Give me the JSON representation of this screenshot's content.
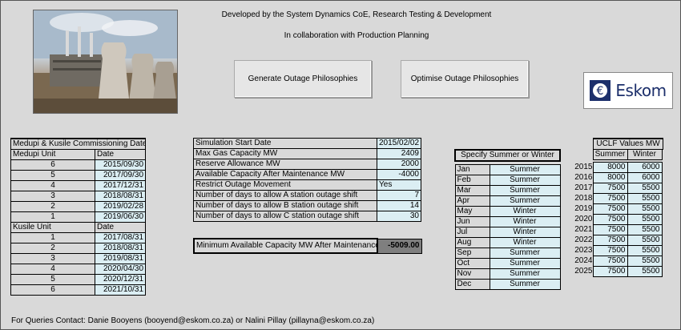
{
  "header": {
    "line1": "Developed by the System Dynamics CoE, Research Testing & Development",
    "line2": "In collaboration with Production Planning"
  },
  "buttons": {
    "generate": "Generate Outage Philosophies",
    "optimise": "Optimise Outage Philosophies"
  },
  "logo": {
    "text": "Eskom",
    "icon": "eskom-logo-icon"
  },
  "commissioning": {
    "title": "Medupi & Kusile Commissioning Dates",
    "medupi_header": [
      "Medupi Unit",
      "Date"
    ],
    "medupi": [
      {
        "unit": "6",
        "date": "2015/09/30"
      },
      {
        "unit": "5",
        "date": "2017/09/30"
      },
      {
        "unit": "4",
        "date": "2017/12/31"
      },
      {
        "unit": "3",
        "date": "2018/08/31"
      },
      {
        "unit": "2",
        "date": "2019/02/28"
      },
      {
        "unit": "1",
        "date": "2019/06/30"
      }
    ],
    "kusile_header": [
      "Kusile Unit",
      "Date"
    ],
    "kusile": [
      {
        "unit": "1",
        "date": "2017/08/31"
      },
      {
        "unit": "2",
        "date": "2018/08/31"
      },
      {
        "unit": "3",
        "date": "2019/08/31"
      },
      {
        "unit": "4",
        "date": "2020/04/30"
      },
      {
        "unit": "5",
        "date": "2020/12/31"
      },
      {
        "unit": "6",
        "date": "2021/10/31"
      }
    ]
  },
  "simulation": {
    "rows": [
      {
        "label": "Simulation Start Date",
        "value": "2015/02/02"
      },
      {
        "label": "Max Gas Capacity MW",
        "value": "2409"
      },
      {
        "label": "Reserve Allowance MW",
        "value": "2000"
      },
      {
        "label": "Available Capacity After Maintenance MW",
        "value": "-4000"
      },
      {
        "label": "Restrict Outage Movement",
        "value": "Yes"
      },
      {
        "label": "Number of days to allow A station outage shift",
        "value": "7"
      },
      {
        "label": "Number of days to allow B station outage shift",
        "value": "14"
      },
      {
        "label": "Number of days to allow C station outage shift",
        "value": "30"
      }
    ],
    "min_label": "Minimum Available Capacity MW After Maintenance",
    "min_value": "-5009.00"
  },
  "season": {
    "title": "Specify Summer or Winter",
    "months": [
      {
        "month": "Jan",
        "season": "Summer"
      },
      {
        "month": "Feb",
        "season": "Summer"
      },
      {
        "month": "Mar",
        "season": "Summer"
      },
      {
        "month": "Apr",
        "season": "Summer"
      },
      {
        "month": "May",
        "season": "Winter"
      },
      {
        "month": "Jun",
        "season": "Winter"
      },
      {
        "month": "Jul",
        "season": "Winter"
      },
      {
        "month": "Aug",
        "season": "Winter"
      },
      {
        "month": "Sep",
        "season": "Summer"
      },
      {
        "month": "Oct",
        "season": "Summer"
      },
      {
        "month": "Nov",
        "season": "Summer"
      },
      {
        "month": "Dec",
        "season": "Summer"
      }
    ]
  },
  "uclf": {
    "title": "UCLF Values MW",
    "headers": [
      "Summer",
      "Winter"
    ],
    "rows": [
      {
        "year": "2015",
        "summer": "8000",
        "winter": "6000"
      },
      {
        "year": "2016",
        "summer": "8000",
        "winter": "6000"
      },
      {
        "year": "2017",
        "summer": "7500",
        "winter": "5500"
      },
      {
        "year": "2018",
        "summer": "7500",
        "winter": "5500"
      },
      {
        "year": "2019",
        "summer": "7500",
        "winter": "5500"
      },
      {
        "year": "2020",
        "summer": "7500",
        "winter": "5500"
      },
      {
        "year": "2021",
        "summer": "7500",
        "winter": "5500"
      },
      {
        "year": "2022",
        "summer": "7500",
        "winter": "5500"
      },
      {
        "year": "2023",
        "summer": "7500",
        "winter": "5500"
      },
      {
        "year": "2024",
        "summer": "7500",
        "winter": "5500"
      },
      {
        "year": "2025",
        "summer": "7500",
        "winter": "5500"
      }
    ]
  },
  "footer": "For Queries Contact: Danie Booyens (booyend@eskom.co.za) or Nalini Pillay (pillayna@eskom.co.za)"
}
